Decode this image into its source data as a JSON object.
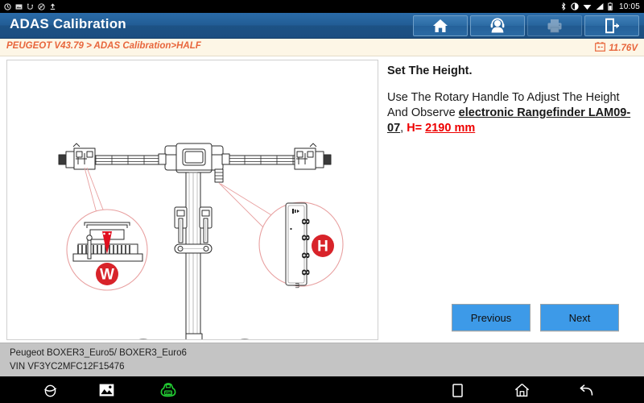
{
  "statusbar": {
    "time": "10:05",
    "left_icons": [
      "sync-icon",
      "screenshot-icon",
      "usb-icon",
      "mute-icon",
      "upload-icon"
    ],
    "right_icons": [
      "bluetooth-icon",
      "brightness-icon",
      "wifi-icon",
      "signal-icon",
      "battery-icon"
    ]
  },
  "header": {
    "title": "ADAS Calibration",
    "buttons": [
      {
        "name": "home-button",
        "icon": "home-icon",
        "enabled": true
      },
      {
        "name": "support-button",
        "icon": "headset-user-icon",
        "enabled": true
      },
      {
        "name": "print-button",
        "icon": "printer-icon",
        "enabled": false
      },
      {
        "name": "exit-button",
        "icon": "exit-door-icon",
        "enabled": true
      }
    ]
  },
  "breadcrumb": {
    "path": "PEUGEOT V43.79 > ADAS Calibration>HALF",
    "voltage": "11.76V",
    "voltage_icon": "battery-voltage-icon",
    "accent_color": "#e8663c"
  },
  "main": {
    "instruction_title": "Set The Height.",
    "instruction_body": {
      "part1": "Use The Rotary Handle To Adjust The Height And Observe ",
      "emphasis": "electronic Rangefinder LAM09-07",
      "part2": ", ",
      "value_label": "H= ",
      "value": "2190 mm"
    },
    "diagram": {
      "name": "adas-calibration-frame-diagram",
      "callouts": [
        {
          "label": "W",
          "desc": "width-scale-pointer-detail"
        },
        {
          "label": "H",
          "desc": "rangefinder-display-detail"
        }
      ],
      "rangefinder_digits": "8 8 8 8",
      "callout_color": "#d8232a",
      "leader_color": "#e8a0a0"
    }
  },
  "footer_buttons": {
    "previous_label": "Previous",
    "next_label": "Next",
    "button_color": "#3d9ae8"
  },
  "vehicle_info": {
    "model": "Peugeot BOXER3_Euro5/ BOXER3_Euro6",
    "vin": "VIN VF3YC2MFC12F15476"
  },
  "navbar": {
    "items": [
      {
        "name": "browser-icon",
        "active": false
      },
      {
        "name": "gallery-icon",
        "active": false
      },
      {
        "name": "vci-connection-icon",
        "active": true,
        "color": "#22cc33"
      },
      {
        "name": "recents-icon",
        "active": false
      },
      {
        "name": "home-nav-icon",
        "active": false
      },
      {
        "name": "back-icon",
        "active": false
      }
    ]
  }
}
